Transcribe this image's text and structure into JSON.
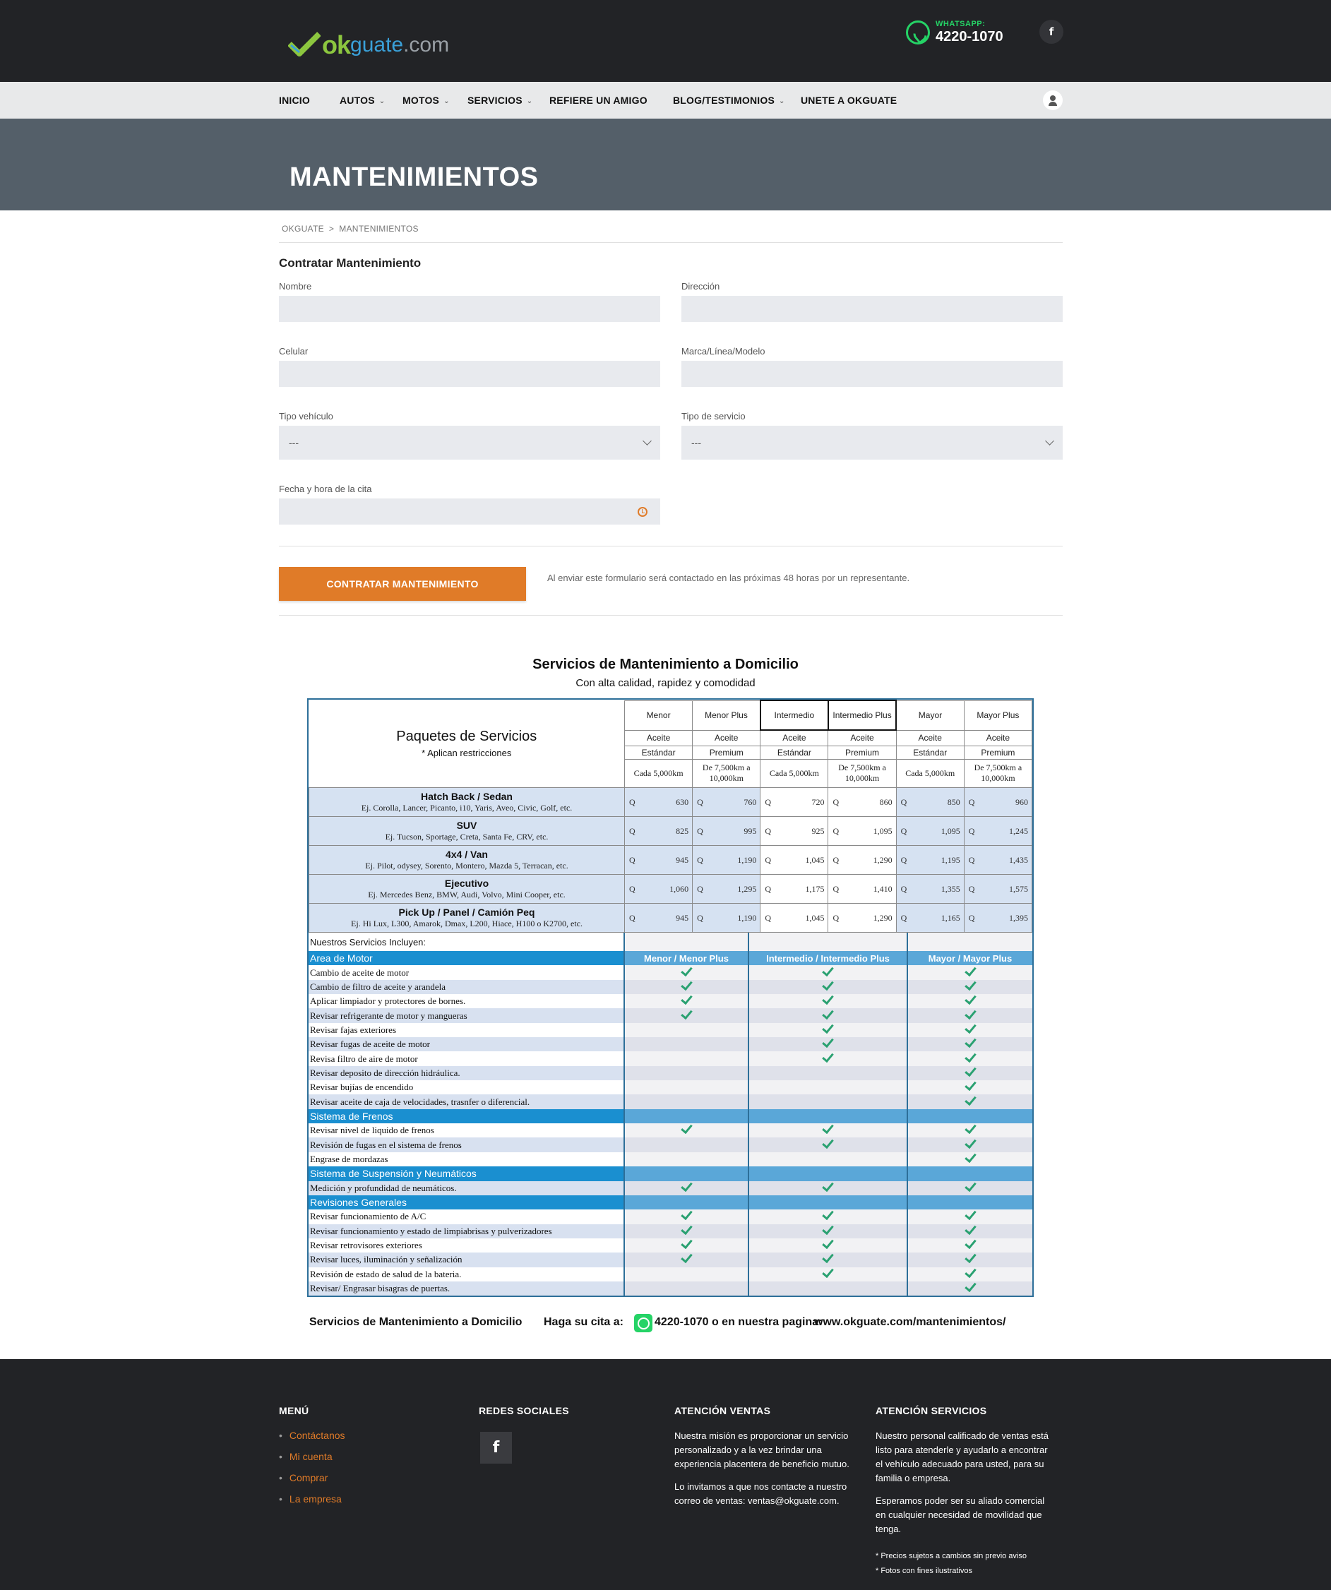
{
  "header": {
    "logo": {
      "ok": "ok",
      "guate": "guate",
      "dotcom": ".com"
    },
    "whatsapp_label": "WHATSAPP:",
    "whatsapp_number": "4220-1070",
    "facebook_icon": "f"
  },
  "nav": {
    "items": [
      {
        "label": "INICIO",
        "dropdown": false
      },
      {
        "label": "AUTOS",
        "dropdown": true
      },
      {
        "label": "MOTOS",
        "dropdown": true
      },
      {
        "label": "SERVICIOS",
        "dropdown": true
      },
      {
        "label": "REFIERE UN AMIGO",
        "dropdown": false
      },
      {
        "label": "BLOG/TESTIMONIOS",
        "dropdown": true
      },
      {
        "label": "UNETE A OKGUATE",
        "dropdown": false
      }
    ]
  },
  "hero": {
    "title": "MANTENIMIENTOS"
  },
  "breadcrumb": {
    "home": "OKGUATE",
    "sep": ">",
    "current": "MANTENIMIENTOS"
  },
  "form": {
    "title": "Contratar Mantenimiento",
    "nombre_label": "Nombre",
    "direccion_label": "Dirección",
    "celular_label": "Celular",
    "marca_label": "Marca/Línea/Modelo",
    "tipo_vehiculo_label": "Tipo vehículo",
    "tipo_vehiculo_value": "---",
    "tipo_servicio_label": "Tipo de servicio",
    "tipo_servicio_value": "---",
    "fecha_label": "Fecha y hora de la cita",
    "submit_label": "CONTRATAR MANTENIMIENTO",
    "submit_note": "Al enviar este formulario será contactado en las próximas 48 horas por un representante."
  },
  "services": {
    "title": "Servicios de Mantenimiento a Domicilio",
    "subtitle": "Con alta calidad, rapidez y comodidad",
    "packages_title": "Paquetes de Servicios",
    "packages_note": "* Aplican restricciones",
    "columns": [
      {
        "name": "Menor",
        "oil": "Aceite",
        "type": "Estándar",
        "every": "Cada 5,000km",
        "bold": false
      },
      {
        "name": "Menor Plus",
        "oil": "Aceite",
        "type": "Premium",
        "every": "De 7,500km a 10,000km",
        "bold": false
      },
      {
        "name": "Intermedio",
        "oil": "Aceite",
        "type": "Estándar",
        "every": "Cada 5,000km",
        "bold": true
      },
      {
        "name": "Intermedio Plus",
        "oil": "Aceite",
        "type": "Premium",
        "every": "De 7,500km a 10,000km",
        "bold": true
      },
      {
        "name": "Mayor",
        "oil": "Aceite",
        "type": "Estándar",
        "every": "Cada 5,000km",
        "bold": false
      },
      {
        "name": "Mayor Plus",
        "oil": "Aceite",
        "type": "Premium",
        "every": "De 7,500km a 10,000km",
        "bold": false
      }
    ],
    "currency": "Q",
    "vehicles": [
      {
        "name": "Hatch Back / Sedan",
        "examples": "Ej. Corolla, Lancer, Picanto, i10, Yaris, Aveo, Civic, Golf, etc.",
        "prices": [
          "630",
          "760",
          "720",
          "860",
          "850",
          "960"
        ]
      },
      {
        "name": "SUV",
        "examples": "Ej. Tucson, Sportage, Creta, Santa Fe, CRV, etc.",
        "prices": [
          "825",
          "995",
          "925",
          "1,095",
          "1,095",
          "1,245"
        ]
      },
      {
        "name": "4x4 / Van",
        "examples": "Ej. Pilot, odysey, Sorento, Montero, Mazda 5, Terracan, etc.",
        "prices": [
          "945",
          "1,190",
          "1,045",
          "1,290",
          "1,195",
          "1,435"
        ]
      },
      {
        "name": "Ejecutivo",
        "examples": "Ej. Mercedes Benz, BMW, Audi, Volvo, Mini Cooper, etc.",
        "prices": [
          "1,060",
          "1,295",
          "1,175",
          "1,410",
          "1,355",
          "1,575"
        ]
      },
      {
        "name": "Pick Up / Panel / Camión Peq",
        "examples": "Ej. Hi Lux, L300, Amarok, Dmax, L200, Hiace, H100 o K2700, etc.",
        "prices": [
          "945",
          "1,190",
          "1,045",
          "1,290",
          "1,165",
          "1,395"
        ]
      }
    ],
    "includes_label": "Nuestros Servicios Incluyen:",
    "group_headers": [
      "Menor / Menor Plus",
      "Intermedio / Intermedio Plus",
      "Mayor / Mayor Plus"
    ],
    "sections": [
      {
        "title": "Area de Motor",
        "rows": [
          {
            "label": "Cambio de aceite de motor",
            "checks": [
              true,
              true,
              true
            ]
          },
          {
            "label": "Cambio de filtro de aceite y arandela",
            "checks": [
              true,
              true,
              true
            ]
          },
          {
            "label": "Aplicar limpiador y protectores de bornes.",
            "checks": [
              true,
              true,
              true
            ]
          },
          {
            "label": "Revisar refrigerante de motor y mangueras",
            "checks": [
              true,
              true,
              true
            ]
          },
          {
            "label": "Revisar fajas exteriores",
            "checks": [
              false,
              true,
              true
            ]
          },
          {
            "label": "Revisar fugas de aceite de motor",
            "checks": [
              false,
              true,
              true
            ]
          },
          {
            "label": "Revisa filtro de aire de motor",
            "checks": [
              false,
              true,
              true
            ]
          },
          {
            "label": "Revisar deposito de dirección hidráulica.",
            "checks": [
              false,
              false,
              true
            ]
          },
          {
            "label": "Revisar bujías de encendido",
            "checks": [
              false,
              false,
              true
            ]
          },
          {
            "label": "Revisar aceite de caja de velocidades, trasnfer o  diferencial.",
            "checks": [
              false,
              false,
              true
            ]
          }
        ]
      },
      {
        "title": "Sistema de Frenos",
        "rows": [
          {
            "label": "Revisar nivel de liquido de frenos",
            "checks": [
              true,
              true,
              true
            ]
          },
          {
            "label": "Revisión de fugas en el sistema de frenos",
            "checks": [
              false,
              true,
              true
            ]
          },
          {
            "label": "Engrase de mordazas",
            "checks": [
              false,
              false,
              true
            ]
          }
        ]
      },
      {
        "title": "Sistema de Suspensión y Neumáticos",
        "rows": [
          {
            "label": "Medición y profundidad de neumáticos.",
            "checks": [
              true,
              true,
              true
            ]
          }
        ]
      },
      {
        "title": "Revisiones Generales",
        "rows": [
          {
            "label": "Revisar funcionamiento de A/C",
            "checks": [
              true,
              true,
              true
            ]
          },
          {
            "label": "Revisar funcionamiento y estado de limpiabrisas y pulverizadores",
            "checks": [
              true,
              true,
              true
            ]
          },
          {
            "label": "Revisar retrovisores exteriores",
            "checks": [
              true,
              true,
              true
            ]
          },
          {
            "label": "Revisar luces, iluminación y señalización",
            "checks": [
              true,
              true,
              true
            ]
          },
          {
            "label": "Revisión de estado de salud de la bateria.",
            "checks": [
              false,
              true,
              true
            ]
          },
          {
            "label": "Revisar/ Engrasar bisagras de puertas.",
            "checks": [
              false,
              false,
              true
            ]
          }
        ]
      }
    ],
    "footer_title": "Servicios de Mantenimiento a Domicilio",
    "footer_cta": "Haga su cita a:",
    "footer_phone": "4220-1070 o en nuestra pagina:",
    "footer_link": "www.okguate.com/mantenimientos/"
  },
  "footer": {
    "menu_title": "MENÚ",
    "menu_items": [
      "Contáctanos",
      "Mi cuenta",
      "Comprar",
      "La empresa"
    ],
    "social_title": "REDES SOCIALES",
    "social_icon": "f",
    "ventas_title": "ATENCIÓN VENTAS",
    "ventas_p1": "Nuestra misión es proporcionar un servicio personalizado y a la vez brindar una experiencia placentera de beneficio mutuo.",
    "ventas_p2": "Lo invitamos a que nos contacte a nuestro correo de ventas: ventas@okguate.com.",
    "servicios_title": "ATENCIÓN SERVICIOS",
    "servicios_p1": "Nuestro personal calificado de ventas está listo para atenderle y ayudarlo a encontrar el vehículo adecuado para usted, para su familia o empresa.",
    "servicios_p2": "Esperamos poder ser su aliado comercial en cualquier necesidad de movilidad que tenga.",
    "note1": "* Precios sujetos a cambios sin previo aviso",
    "note2": "* Fotos con fines ilustrativos"
  }
}
